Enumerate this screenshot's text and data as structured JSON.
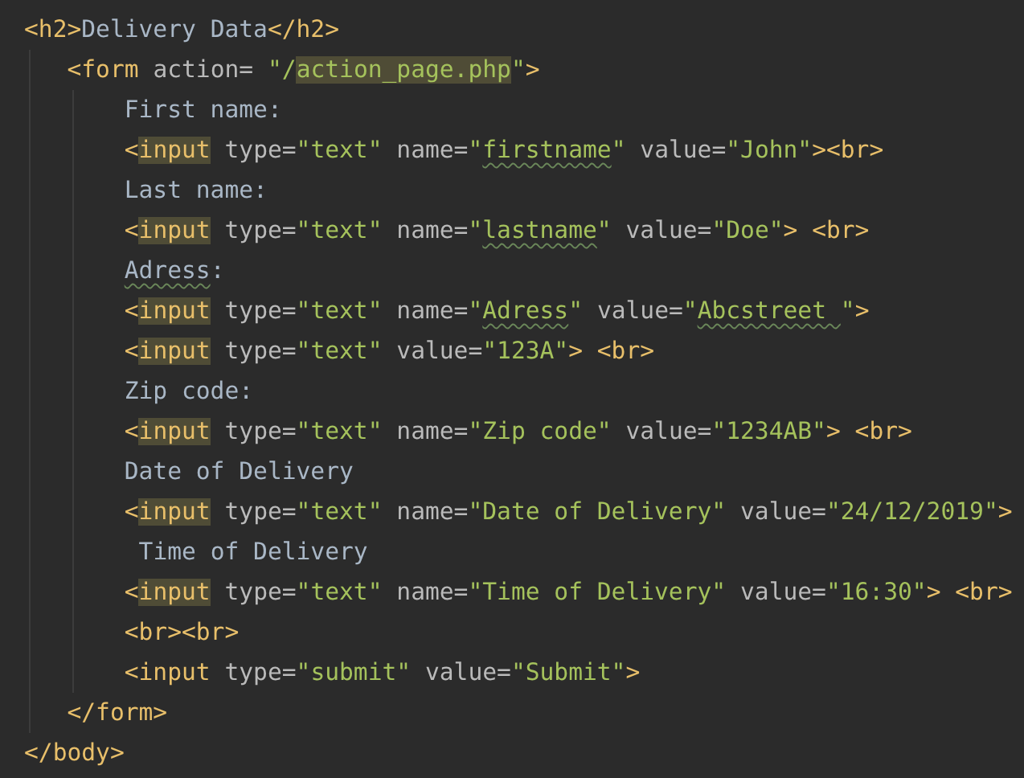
{
  "editor": {
    "lines": [
      {
        "tokens": [
          {
            "text": "<h2>",
            "kind": "tag",
            "highlighted": false,
            "misspelled": false
          },
          {
            "text": "Delivery Data",
            "kind": "text",
            "highlighted": false,
            "misspelled": false
          },
          {
            "text": "</h2>",
            "kind": "tag",
            "highlighted": false,
            "misspelled": false
          }
        ]
      },
      {
        "tokens": [
          {
            "text": "   <form",
            "kind": "tag",
            "highlighted": false,
            "misspelled": false
          },
          {
            "text": " action= ",
            "kind": "attr",
            "highlighted": false,
            "misspelled": false
          },
          {
            "text": "\"/",
            "kind": "string",
            "highlighted": false,
            "misspelled": false
          },
          {
            "text": "action_page.php",
            "kind": "string",
            "highlighted": true,
            "misspelled": false
          },
          {
            "text": "\"",
            "kind": "string",
            "highlighted": false,
            "misspelled": false
          },
          {
            "text": ">",
            "kind": "tag",
            "highlighted": false,
            "misspelled": false
          }
        ]
      },
      {
        "tokens": [
          {
            "text": "       First name:",
            "kind": "text",
            "highlighted": false,
            "misspelled": false
          }
        ]
      },
      {
        "tokens": [
          {
            "text": "       <",
            "kind": "tag",
            "highlighted": false,
            "misspelled": false
          },
          {
            "text": "input",
            "kind": "tag",
            "highlighted": true,
            "misspelled": false
          },
          {
            "text": " type=",
            "kind": "attr",
            "highlighted": false,
            "misspelled": false
          },
          {
            "text": "\"text\"",
            "kind": "string",
            "highlighted": false,
            "misspelled": false
          },
          {
            "text": " name=",
            "kind": "attr",
            "highlighted": false,
            "misspelled": false
          },
          {
            "text": "\"",
            "kind": "string",
            "highlighted": false,
            "misspelled": false
          },
          {
            "text": "firstname",
            "kind": "string",
            "highlighted": false,
            "misspelled": true
          },
          {
            "text": "\"",
            "kind": "string",
            "highlighted": false,
            "misspelled": false
          },
          {
            "text": " value=",
            "kind": "attr",
            "highlighted": false,
            "misspelled": false
          },
          {
            "text": "\"John\"",
            "kind": "string",
            "highlighted": false,
            "misspelled": false
          },
          {
            "text": "><br>",
            "kind": "tag",
            "highlighted": false,
            "misspelled": false
          }
        ]
      },
      {
        "tokens": [
          {
            "text": "       Last name:",
            "kind": "text",
            "highlighted": false,
            "misspelled": false
          }
        ]
      },
      {
        "tokens": [
          {
            "text": "       <",
            "kind": "tag",
            "highlighted": false,
            "misspelled": false
          },
          {
            "text": "input",
            "kind": "tag",
            "highlighted": true,
            "misspelled": false
          },
          {
            "text": " type=",
            "kind": "attr",
            "highlighted": false,
            "misspelled": false
          },
          {
            "text": "\"text\"",
            "kind": "string",
            "highlighted": false,
            "misspelled": false
          },
          {
            "text": " name=",
            "kind": "attr",
            "highlighted": false,
            "misspelled": false
          },
          {
            "text": "\"",
            "kind": "string",
            "highlighted": false,
            "misspelled": false
          },
          {
            "text": "lastname",
            "kind": "string",
            "highlighted": false,
            "misspelled": true
          },
          {
            "text": "\"",
            "kind": "string",
            "highlighted": false,
            "misspelled": false
          },
          {
            "text": " value=",
            "kind": "attr",
            "highlighted": false,
            "misspelled": false
          },
          {
            "text": "\"Doe\"",
            "kind": "string",
            "highlighted": false,
            "misspelled": false
          },
          {
            "text": "> <br>",
            "kind": "tag",
            "highlighted": false,
            "misspelled": false
          }
        ]
      },
      {
        "tokens": [
          {
            "text": "       Adress",
            "kind": "text",
            "highlighted": false,
            "misspelled": true
          },
          {
            "text": ":",
            "kind": "text",
            "highlighted": false,
            "misspelled": false
          }
        ]
      },
      {
        "tokens": [
          {
            "text": "       <",
            "kind": "tag",
            "highlighted": false,
            "misspelled": false
          },
          {
            "text": "input",
            "kind": "tag",
            "highlighted": true,
            "misspelled": false
          },
          {
            "text": " type=",
            "kind": "attr",
            "highlighted": false,
            "misspelled": false
          },
          {
            "text": "\"text\"",
            "kind": "string",
            "highlighted": false,
            "misspelled": false
          },
          {
            "text": " name=",
            "kind": "attr",
            "highlighted": false,
            "misspelled": false
          },
          {
            "text": "\"",
            "kind": "string",
            "highlighted": false,
            "misspelled": false
          },
          {
            "text": "Adress",
            "kind": "string",
            "highlighted": false,
            "misspelled": true
          },
          {
            "text": "\"",
            "kind": "string",
            "highlighted": false,
            "misspelled": false
          },
          {
            "text": " value=",
            "kind": "attr",
            "highlighted": false,
            "misspelled": false
          },
          {
            "text": "\"",
            "kind": "string",
            "highlighted": false,
            "misspelled": false
          },
          {
            "text": "Abcstreet ",
            "kind": "string",
            "highlighted": false,
            "misspelled": true
          },
          {
            "text": "\"",
            "kind": "string",
            "highlighted": false,
            "misspelled": false
          },
          {
            "text": ">",
            "kind": "tag",
            "highlighted": false,
            "misspelled": false
          }
        ]
      },
      {
        "tokens": [
          {
            "text": "       <",
            "kind": "tag",
            "highlighted": false,
            "misspelled": false
          },
          {
            "text": "input",
            "kind": "tag",
            "highlighted": true,
            "misspelled": false
          },
          {
            "text": " type=",
            "kind": "attr",
            "highlighted": false,
            "misspelled": false
          },
          {
            "text": "\"text\"",
            "kind": "string",
            "highlighted": false,
            "misspelled": false
          },
          {
            "text": " value=",
            "kind": "attr",
            "highlighted": false,
            "misspelled": false
          },
          {
            "text": "\"123A\"",
            "kind": "string",
            "highlighted": false,
            "misspelled": false
          },
          {
            "text": "> <br>",
            "kind": "tag",
            "highlighted": false,
            "misspelled": false
          }
        ]
      },
      {
        "tokens": [
          {
            "text": "       Zip code:",
            "kind": "text",
            "highlighted": false,
            "misspelled": false
          }
        ]
      },
      {
        "tokens": [
          {
            "text": "       <",
            "kind": "tag",
            "highlighted": false,
            "misspelled": false
          },
          {
            "text": "input",
            "kind": "tag",
            "highlighted": true,
            "misspelled": false
          },
          {
            "text": " type=",
            "kind": "attr",
            "highlighted": false,
            "misspelled": false
          },
          {
            "text": "\"text\"",
            "kind": "string",
            "highlighted": false,
            "misspelled": false
          },
          {
            "text": " name=",
            "kind": "attr",
            "highlighted": false,
            "misspelled": false
          },
          {
            "text": "\"Zip code\"",
            "kind": "string",
            "highlighted": false,
            "misspelled": false
          },
          {
            "text": " value=",
            "kind": "attr",
            "highlighted": false,
            "misspelled": false
          },
          {
            "text": "\"1234AB\"",
            "kind": "string",
            "highlighted": false,
            "misspelled": false
          },
          {
            "text": "> <br>",
            "kind": "tag",
            "highlighted": false,
            "misspelled": false
          }
        ]
      },
      {
        "tokens": [
          {
            "text": "       Date of Delivery",
            "kind": "text",
            "highlighted": false,
            "misspelled": false
          }
        ]
      },
      {
        "tokens": [
          {
            "text": "       <",
            "kind": "tag",
            "highlighted": false,
            "misspelled": false
          },
          {
            "text": "input",
            "kind": "tag",
            "highlighted": true,
            "misspelled": false
          },
          {
            "text": " type=",
            "kind": "attr",
            "highlighted": false,
            "misspelled": false
          },
          {
            "text": "\"text\"",
            "kind": "string",
            "highlighted": false,
            "misspelled": false
          },
          {
            "text": " name=",
            "kind": "attr",
            "highlighted": false,
            "misspelled": false
          },
          {
            "text": "\"Date of Delivery\"",
            "kind": "string",
            "highlighted": false,
            "misspelled": false
          },
          {
            "text": " value=",
            "kind": "attr",
            "highlighted": false,
            "misspelled": false
          },
          {
            "text": "\"24/12/2019\"",
            "kind": "string",
            "highlighted": false,
            "misspelled": false
          },
          {
            "text": ">",
            "kind": "tag",
            "highlighted": false,
            "misspelled": false
          }
        ]
      },
      {
        "tokens": [
          {
            "text": "        Time of Delivery",
            "kind": "text",
            "highlighted": false,
            "misspelled": false
          }
        ]
      },
      {
        "tokens": [
          {
            "text": "       <",
            "kind": "tag",
            "highlighted": false,
            "misspelled": false
          },
          {
            "text": "input",
            "kind": "tag",
            "highlighted": true,
            "misspelled": false
          },
          {
            "text": " type=",
            "kind": "attr",
            "highlighted": false,
            "misspelled": false
          },
          {
            "text": "\"text\"",
            "kind": "string",
            "highlighted": false,
            "misspelled": false
          },
          {
            "text": " name=",
            "kind": "attr",
            "highlighted": false,
            "misspelled": false
          },
          {
            "text": "\"Time of Delivery\"",
            "kind": "string",
            "highlighted": false,
            "misspelled": false
          },
          {
            "text": " value=",
            "kind": "attr",
            "highlighted": false,
            "misspelled": false
          },
          {
            "text": "\"16:30\"",
            "kind": "string",
            "highlighted": false,
            "misspelled": false
          },
          {
            "text": "> <br>",
            "kind": "tag",
            "highlighted": false,
            "misspelled": false
          }
        ]
      },
      {
        "tokens": [
          {
            "text": "       <br><br>",
            "kind": "tag",
            "highlighted": false,
            "misspelled": false
          }
        ]
      },
      {
        "tokens": [
          {
            "text": "       <input",
            "kind": "tag",
            "highlighted": false,
            "misspelled": false
          },
          {
            "text": " type=",
            "kind": "attr",
            "highlighted": false,
            "misspelled": false
          },
          {
            "text": "\"submit\"",
            "kind": "string",
            "highlighted": false,
            "misspelled": false
          },
          {
            "text": " value=",
            "kind": "attr",
            "highlighted": false,
            "misspelled": false
          },
          {
            "text": "\"Submit\"",
            "kind": "string",
            "highlighted": false,
            "misspelled": false
          },
          {
            "text": ">",
            "kind": "tag",
            "highlighted": false,
            "misspelled": false
          }
        ]
      },
      {
        "tokens": [
          {
            "text": "   </form>",
            "kind": "tag",
            "highlighted": false,
            "misspelled": false
          }
        ]
      },
      {
        "tokens": [
          {
            "text": "</body>",
            "kind": "tag",
            "highlighted": false,
            "misspelled": false
          }
        ]
      }
    ]
  }
}
